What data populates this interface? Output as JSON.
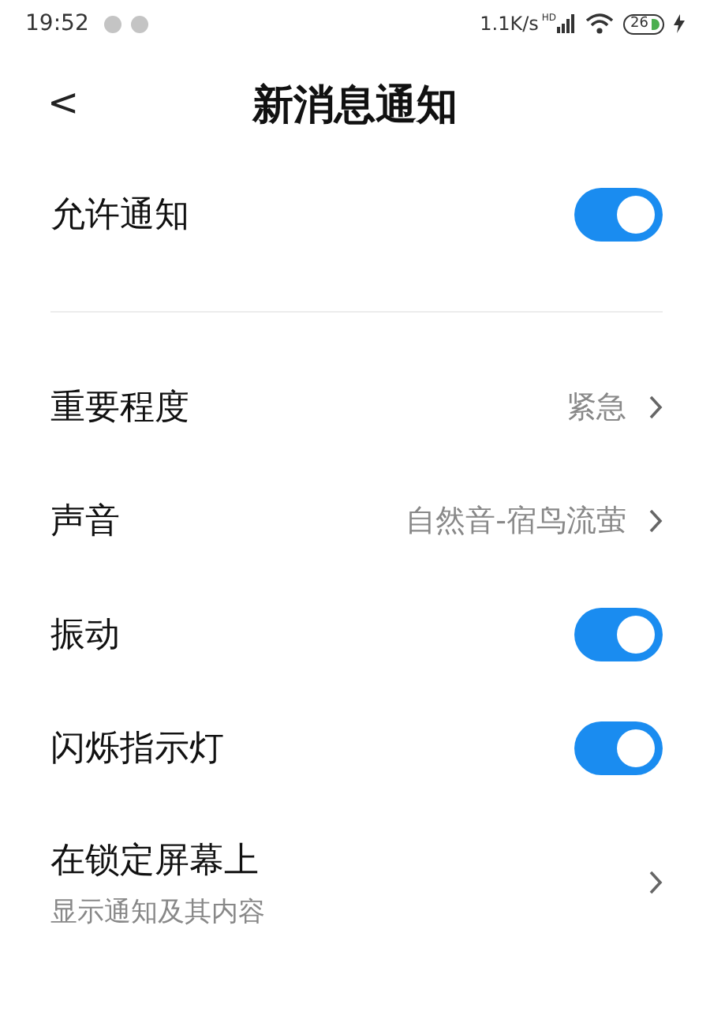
{
  "status_bar": {
    "time": "19:52",
    "speed": "1.1K/s",
    "network": "HD",
    "battery": "26",
    "charging": true
  },
  "header": {
    "back": "<",
    "title": "新消息通知"
  },
  "main_setting": {
    "label": "允许通知",
    "on": true
  },
  "settings": [
    {
      "kind": "link",
      "label": "重要程度",
      "value": "紧急"
    },
    {
      "kind": "link",
      "label": "声音",
      "value": "自然音-宿鸟流萤"
    },
    {
      "kind": "toggle",
      "label": "振动",
      "on": true
    },
    {
      "kind": "toggle",
      "label": "闪烁指示灯",
      "on": true
    },
    {
      "kind": "link",
      "label": "在锁定屏幕上",
      "subtitle": "显示通知及其内容"
    }
  ]
}
